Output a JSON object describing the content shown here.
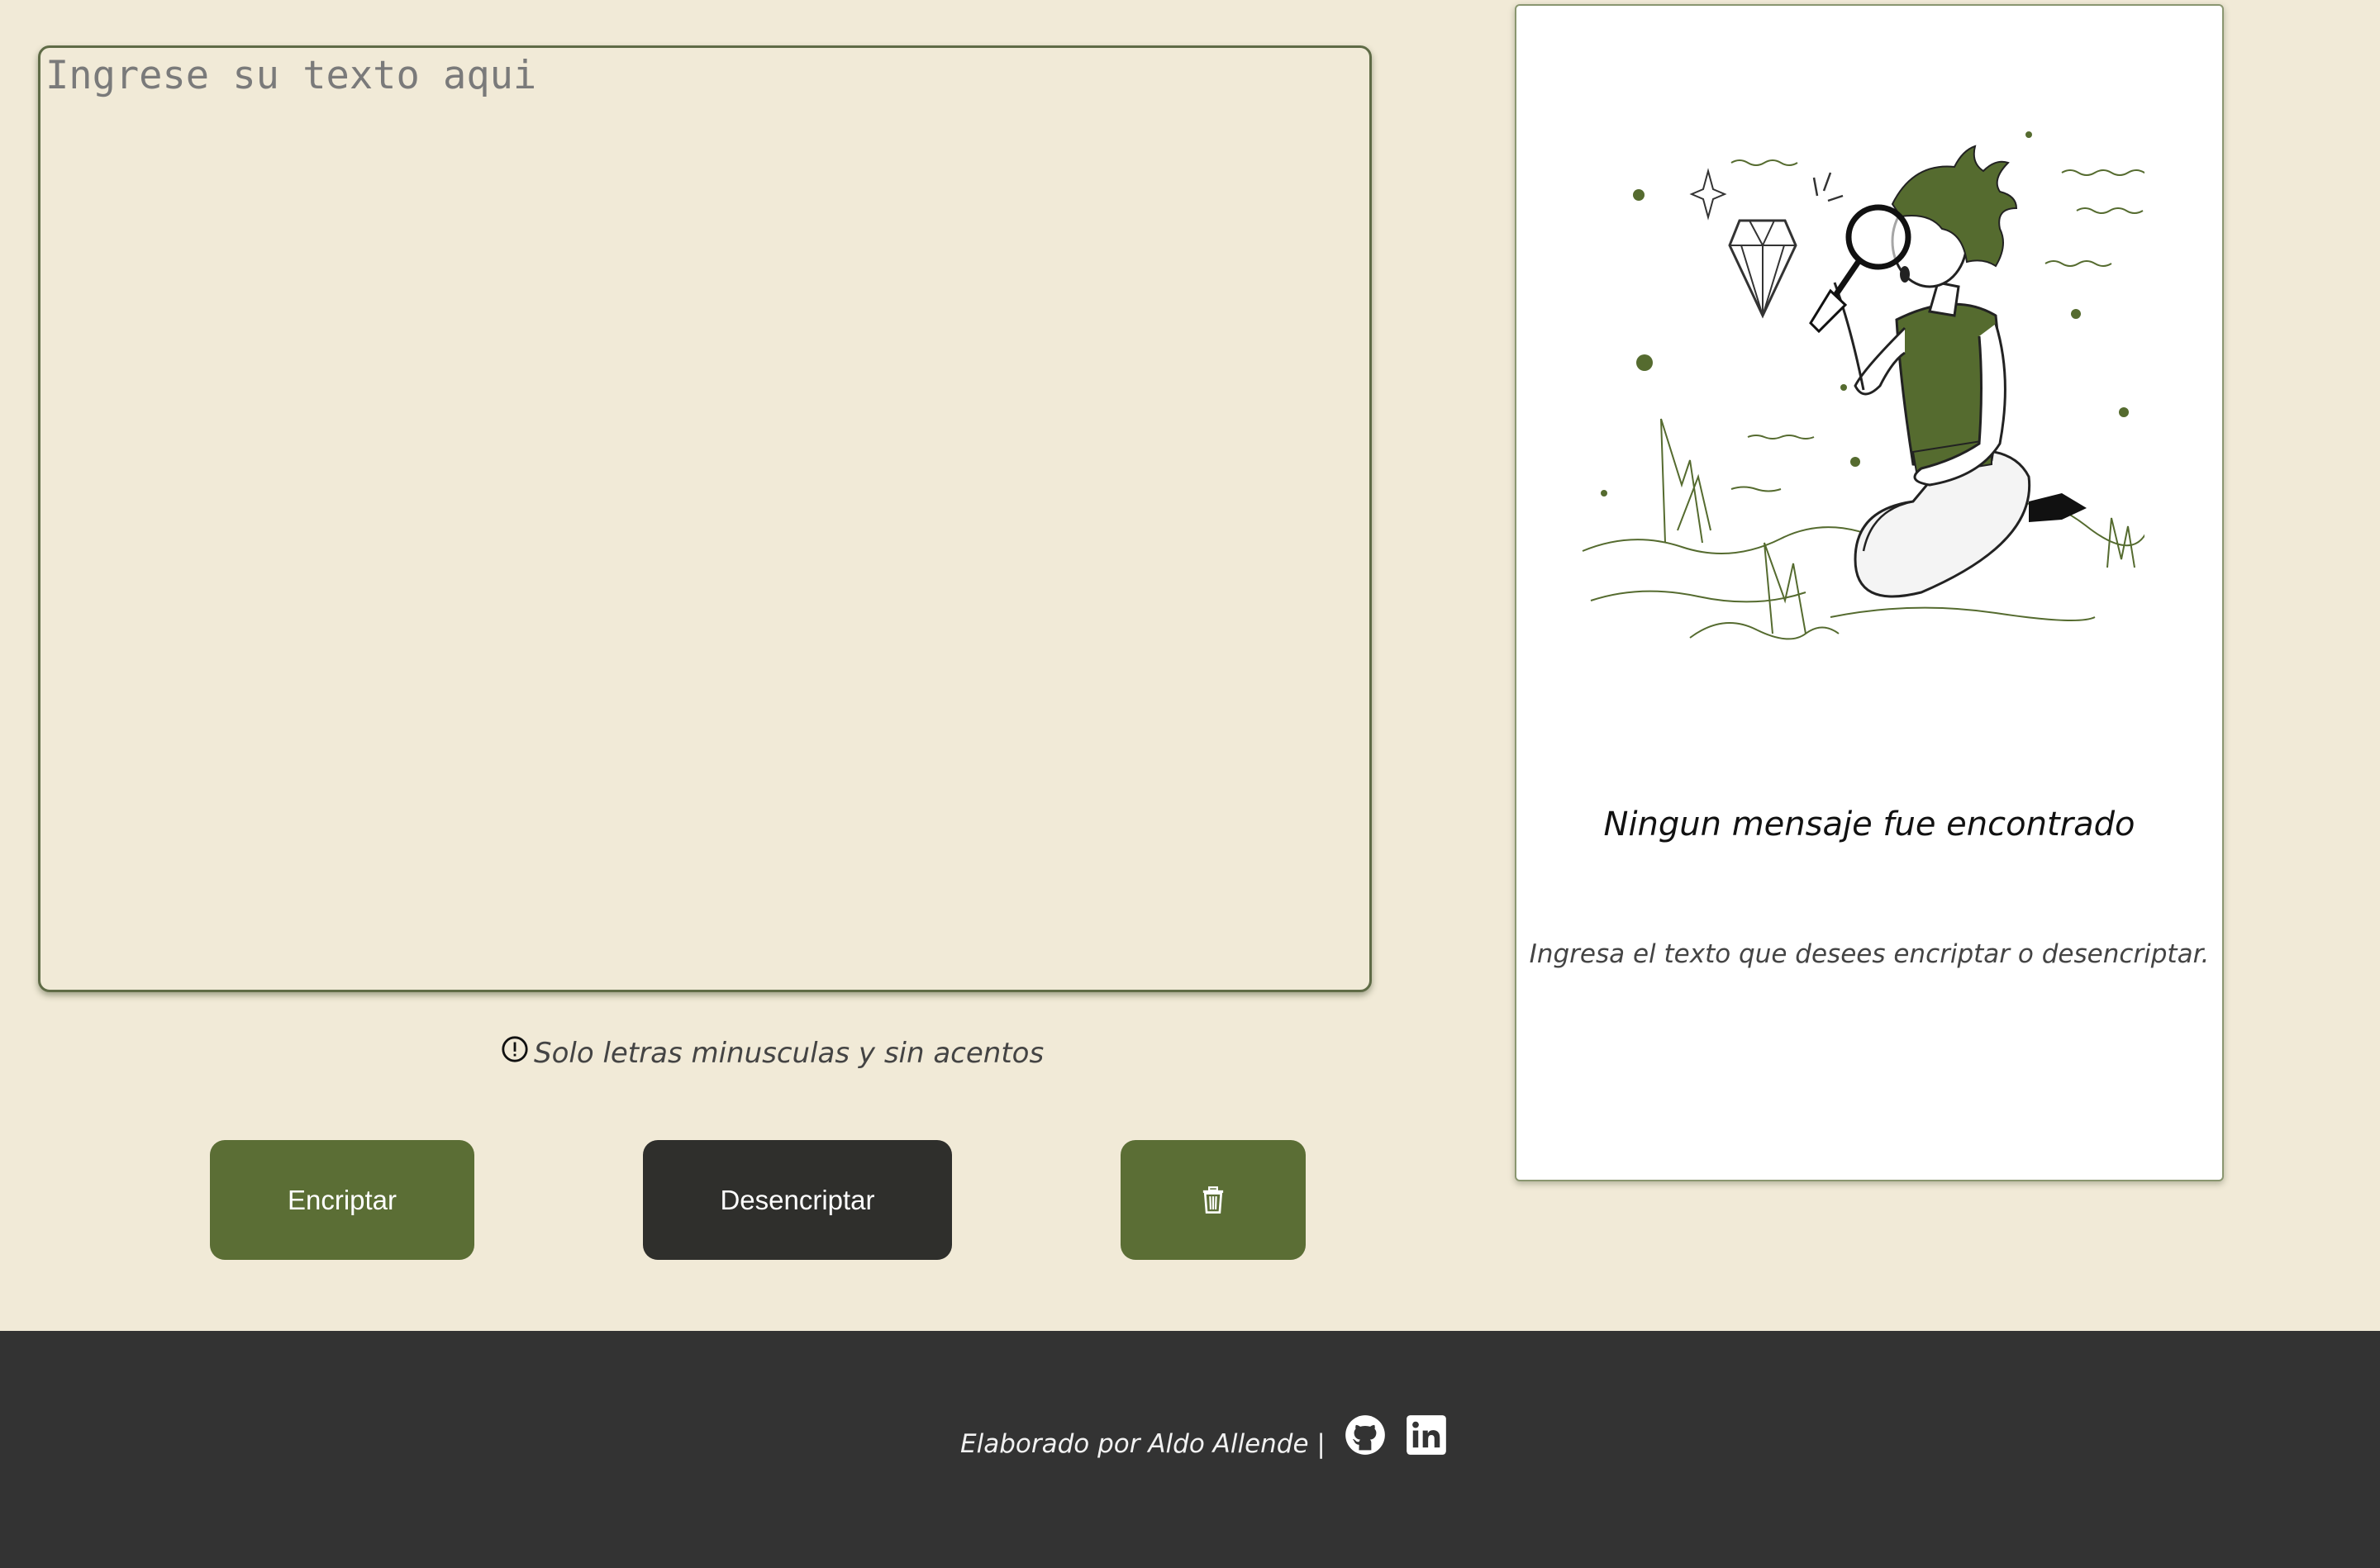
{
  "input": {
    "placeholder": "Ingrese su texto aqui",
    "value": ""
  },
  "notice": {
    "icon": "alert-circle-icon",
    "text": "Solo letras minusculas y sin acentos"
  },
  "buttons": {
    "encrypt_label": "Encriptar",
    "decrypt_label": "Desencriptar",
    "clear_icon": "trash-icon"
  },
  "result": {
    "illustration": "person-with-magnifying-glass-diamond",
    "title": "Ningun mensaje fue encontrado",
    "subtitle": "Ingresa el texto que desees encriptar o desencriptar."
  },
  "footer": {
    "credit": "Elaborado por Aldo Allende |",
    "links": [
      {
        "icon": "github-icon"
      },
      {
        "icon": "linkedin-icon"
      }
    ]
  },
  "colors": {
    "background": "#F1EAD7",
    "accent": "#5B6E35",
    "dark_button": "#2F2F2C",
    "footer": "#333333",
    "panel": "#FFFFFF"
  }
}
